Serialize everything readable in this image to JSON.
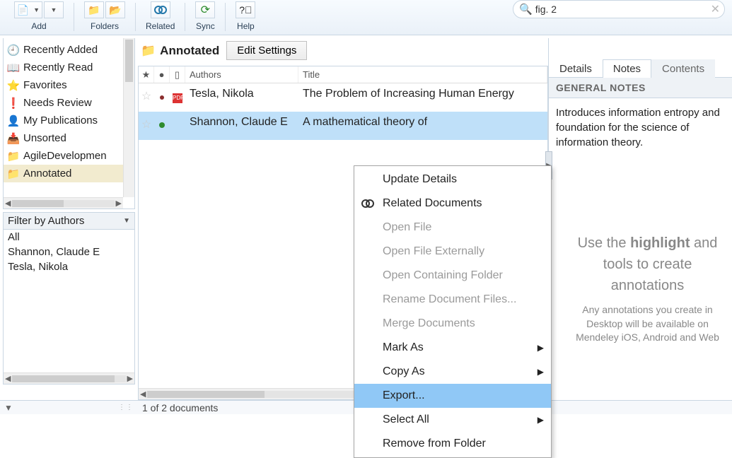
{
  "toolbar": {
    "add": "Add",
    "folders": "Folders",
    "related": "Related",
    "sync": "Sync",
    "help": "Help"
  },
  "search": {
    "query": "fig. 2"
  },
  "sidebar": {
    "items": [
      {
        "icon": "clock",
        "label": "Recently Added"
      },
      {
        "icon": "book",
        "label": "Recently Read"
      },
      {
        "icon": "star",
        "label": "Favorites"
      },
      {
        "icon": "warn",
        "label": "Needs Review"
      },
      {
        "icon": "person",
        "label": "My Publications"
      },
      {
        "icon": "tray",
        "label": "Unsorted"
      },
      {
        "icon": "folder",
        "label": "AgileDevelopmen"
      },
      {
        "icon": "folder",
        "label": "Annotated"
      }
    ],
    "selected_index": 7
  },
  "filter": {
    "header": "Filter by Authors",
    "items": [
      "All",
      "Shannon, Claude E",
      "Tesla, Nikola"
    ]
  },
  "breadcrumb": {
    "folder": "Annotated",
    "edit_settings": "Edit Settings"
  },
  "table": {
    "headers": {
      "authors": "Authors",
      "title": "Title"
    },
    "rows": [
      {
        "star": false,
        "dot": "red",
        "doc": "pdf",
        "author": "Tesla, Nikola",
        "title": "The Problem of Increasing Human Energy"
      },
      {
        "star": false,
        "dot": "green",
        "doc": "",
        "author": "Shannon, Claude E",
        "title": "A mathematical theory of"
      }
    ],
    "selected_index": 1
  },
  "context_menu": {
    "items": [
      {
        "label": "Update Details",
        "enabled": true
      },
      {
        "label": "Related Documents",
        "enabled": true,
        "icon": "related"
      },
      {
        "label": "Open File",
        "enabled": false
      },
      {
        "label": "Open File Externally",
        "enabled": false
      },
      {
        "label": "Open Containing Folder",
        "enabled": false
      },
      {
        "label": "Rename Document Files...",
        "enabled": false
      },
      {
        "label": "Merge Documents",
        "enabled": false
      },
      {
        "label": "Mark As",
        "enabled": true,
        "submenu": true
      },
      {
        "label": "Copy As",
        "enabled": true,
        "submenu": true
      },
      {
        "label": "Export...",
        "enabled": true,
        "highlight": true
      },
      {
        "label": "Select All",
        "enabled": true,
        "submenu": true
      },
      {
        "label": "Remove from Folder",
        "enabled": true
      }
    ]
  },
  "right_panel": {
    "tabs": {
      "details": "Details",
      "notes": "Notes",
      "contents": "Contents"
    },
    "active_tab": "notes",
    "general_notes_header": "GENERAL NOTES",
    "general_notes_body": "Introduces information entropy and foundation for the science of information theory.",
    "hint_line1a": "Use the ",
    "hint_highlight": "highlight",
    "hint_line1b": " and",
    "hint_line2": "tools to create annotations",
    "hint_sub": "Any annotations you create in Desktop will be available on Mendeley iOS, Android and Web"
  },
  "status": {
    "count": "1 of 2 documents"
  }
}
